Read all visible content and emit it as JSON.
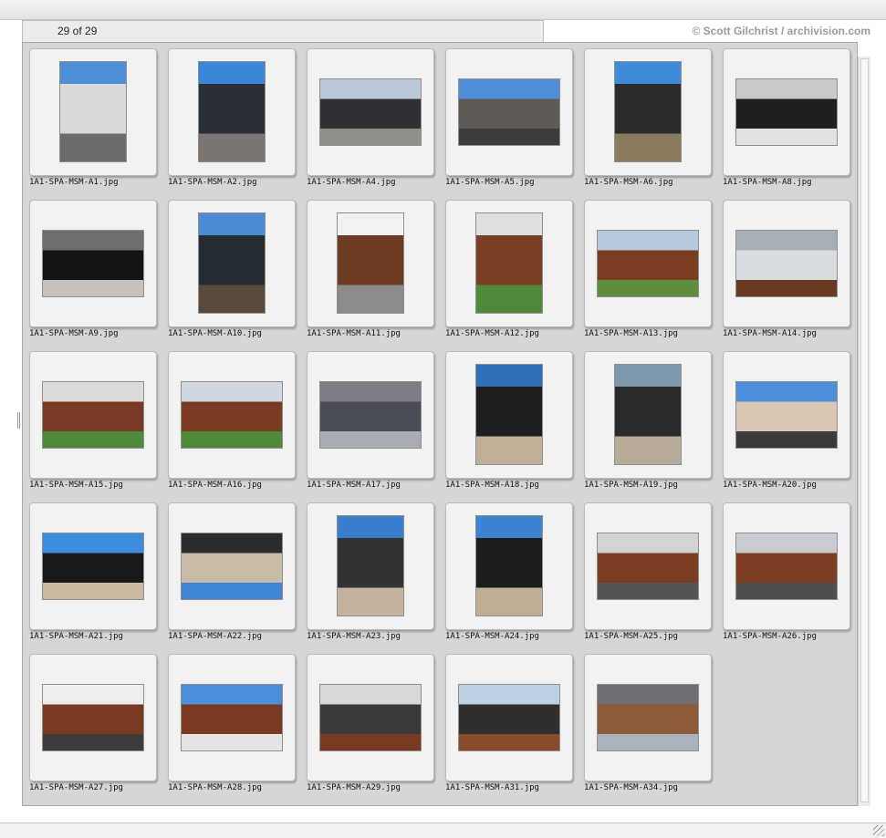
{
  "header": {
    "counter": "29 of 29",
    "copyright": "© Scott Gilchrist / archivision.com"
  },
  "thumbnails": [
    {
      "filename": "1A1-SPA-MSM-A1.jpg",
      "orientation": "portrait",
      "palette": [
        "#4f8fd6",
        "#d9d9d9",
        "#6b6b6b"
      ]
    },
    {
      "filename": "1A1-SPA-MSM-A2.jpg",
      "orientation": "portrait",
      "palette": [
        "#3a86d8",
        "#2b2f36",
        "#7a7570"
      ]
    },
    {
      "filename": "1A1-SPA-MSM-A4.jpg",
      "orientation": "landscape",
      "palette": [
        "#b9c8d6",
        "#2f3135",
        "#8f8f8a"
      ]
    },
    {
      "filename": "1A1-SPA-MSM-A5.jpg",
      "orientation": "landscape",
      "palette": [
        "#4e8fd8",
        "#5e5a55",
        "#3c3c3c"
      ]
    },
    {
      "filename": "1A1-SPA-MSM-A6.jpg",
      "orientation": "portrait",
      "palette": [
        "#3e8bd9",
        "#2c2c2c",
        "#8a7a5e"
      ]
    },
    {
      "filename": "1A1-SPA-MSM-A8.jpg",
      "orientation": "landscape",
      "palette": [
        "#c9c9c9",
        "#1f1f1f",
        "#e2e2e2"
      ]
    },
    {
      "filename": "1A1-SPA-MSM-A9.jpg",
      "orientation": "landscape",
      "palette": [
        "#6e6e6e",
        "#141414",
        "#c7c1ba"
      ]
    },
    {
      "filename": "1A1-SPA-MSM-A10.jpg",
      "orientation": "portrait",
      "palette": [
        "#4a8bd4",
        "#262c33",
        "#5a4a3d"
      ]
    },
    {
      "filename": "1A1-SPA-MSM-A11.jpg",
      "orientation": "portrait",
      "palette": [
        "#f1f1f1",
        "#6d3b22",
        "#8b8b8b"
      ]
    },
    {
      "filename": "1A1-SPA-MSM-A12.jpg",
      "orientation": "portrait",
      "palette": [
        "#dfdfdf",
        "#7a3e22",
        "#4f8a3b"
      ]
    },
    {
      "filename": "1A1-SPA-MSM-A13.jpg",
      "orientation": "landscape",
      "palette": [
        "#b7c9dc",
        "#7b3d22",
        "#5d8f3e"
      ]
    },
    {
      "filename": "1A1-SPA-MSM-A14.jpg",
      "orientation": "landscape",
      "palette": [
        "#a8aeb6",
        "#d9dde2",
        "#6a3a20"
      ]
    },
    {
      "filename": "1A1-SPA-MSM-A15.jpg",
      "orientation": "landscape",
      "palette": [
        "#dcdcdc",
        "#7a3922",
        "#4f8a3b"
      ]
    },
    {
      "filename": "1A1-SPA-MSM-A16.jpg",
      "orientation": "landscape",
      "palette": [
        "#cfd8e0",
        "#7a3b22",
        "#4f8a3b"
      ]
    },
    {
      "filename": "1A1-SPA-MSM-A17.jpg",
      "orientation": "landscape",
      "palette": [
        "#7d7d85",
        "#4a4c55",
        "#a7abb2"
      ]
    },
    {
      "filename": "1A1-SPA-MSM-A18.jpg",
      "orientation": "portrait",
      "palette": [
        "#2f6fb8",
        "#1e1e1e",
        "#bfae98"
      ]
    },
    {
      "filename": "1A1-SPA-MSM-A19.jpg",
      "orientation": "portrait",
      "palette": [
        "#7f98ae",
        "#2a2a2a",
        "#b8aa98"
      ]
    },
    {
      "filename": "1A1-SPA-MSM-A20.jpg",
      "orientation": "landscape",
      "palette": [
        "#4d8fdb",
        "#d9c7b4",
        "#3a3a3a"
      ]
    },
    {
      "filename": "1A1-SPA-MSM-A21.jpg",
      "orientation": "landscape",
      "palette": [
        "#3e8cdd",
        "#1a1a1a",
        "#c9b8a2"
      ]
    },
    {
      "filename": "1A1-SPA-MSM-A22.jpg",
      "orientation": "landscape",
      "palette": [
        "#2b2b2b",
        "#c9bba8",
        "#3f86d6"
      ]
    },
    {
      "filename": "1A1-SPA-MSM-A23.jpg",
      "orientation": "portrait",
      "palette": [
        "#3a7fcf",
        "#333333",
        "#c2b29e"
      ]
    },
    {
      "filename": "1A1-SPA-MSM-A24.jpg",
      "orientation": "portrait",
      "palette": [
        "#3b84d4",
        "#1d1d1d",
        "#bfad96"
      ]
    },
    {
      "filename": "1A1-SPA-MSM-A25.jpg",
      "orientation": "landscape",
      "palette": [
        "#d3d3d3",
        "#7b3c22",
        "#555555"
      ]
    },
    {
      "filename": "1A1-SPA-MSM-A26.jpg",
      "orientation": "landscape",
      "palette": [
        "#c8ccd2",
        "#7b3c22",
        "#4e4e4e"
      ]
    },
    {
      "filename": "1A1-SPA-MSM-A27.jpg",
      "orientation": "landscape",
      "palette": [
        "#ededed",
        "#7a3a22",
        "#3c3c3c"
      ]
    },
    {
      "filename": "1A1-SPA-MSM-A28.jpg",
      "orientation": "landscape",
      "palette": [
        "#4b8fd9",
        "#7a3a22",
        "#e4e4e4"
      ]
    },
    {
      "filename": "1A1-SPA-MSM-A29.jpg",
      "orientation": "landscape",
      "palette": [
        "#d9d9d9",
        "#3a3a3a",
        "#7a3a22"
      ]
    },
    {
      "filename": "1A1-SPA-MSM-A31.jpg",
      "orientation": "landscape",
      "palette": [
        "#bcd0e2",
        "#2f2f2f",
        "#8a4a2c"
      ]
    },
    {
      "filename": "1A1-SPA-MSM-A34.jpg",
      "orientation": "landscape",
      "palette": [
        "#6f6f73",
        "#8d5a3a",
        "#a8b3bd"
      ]
    }
  ]
}
